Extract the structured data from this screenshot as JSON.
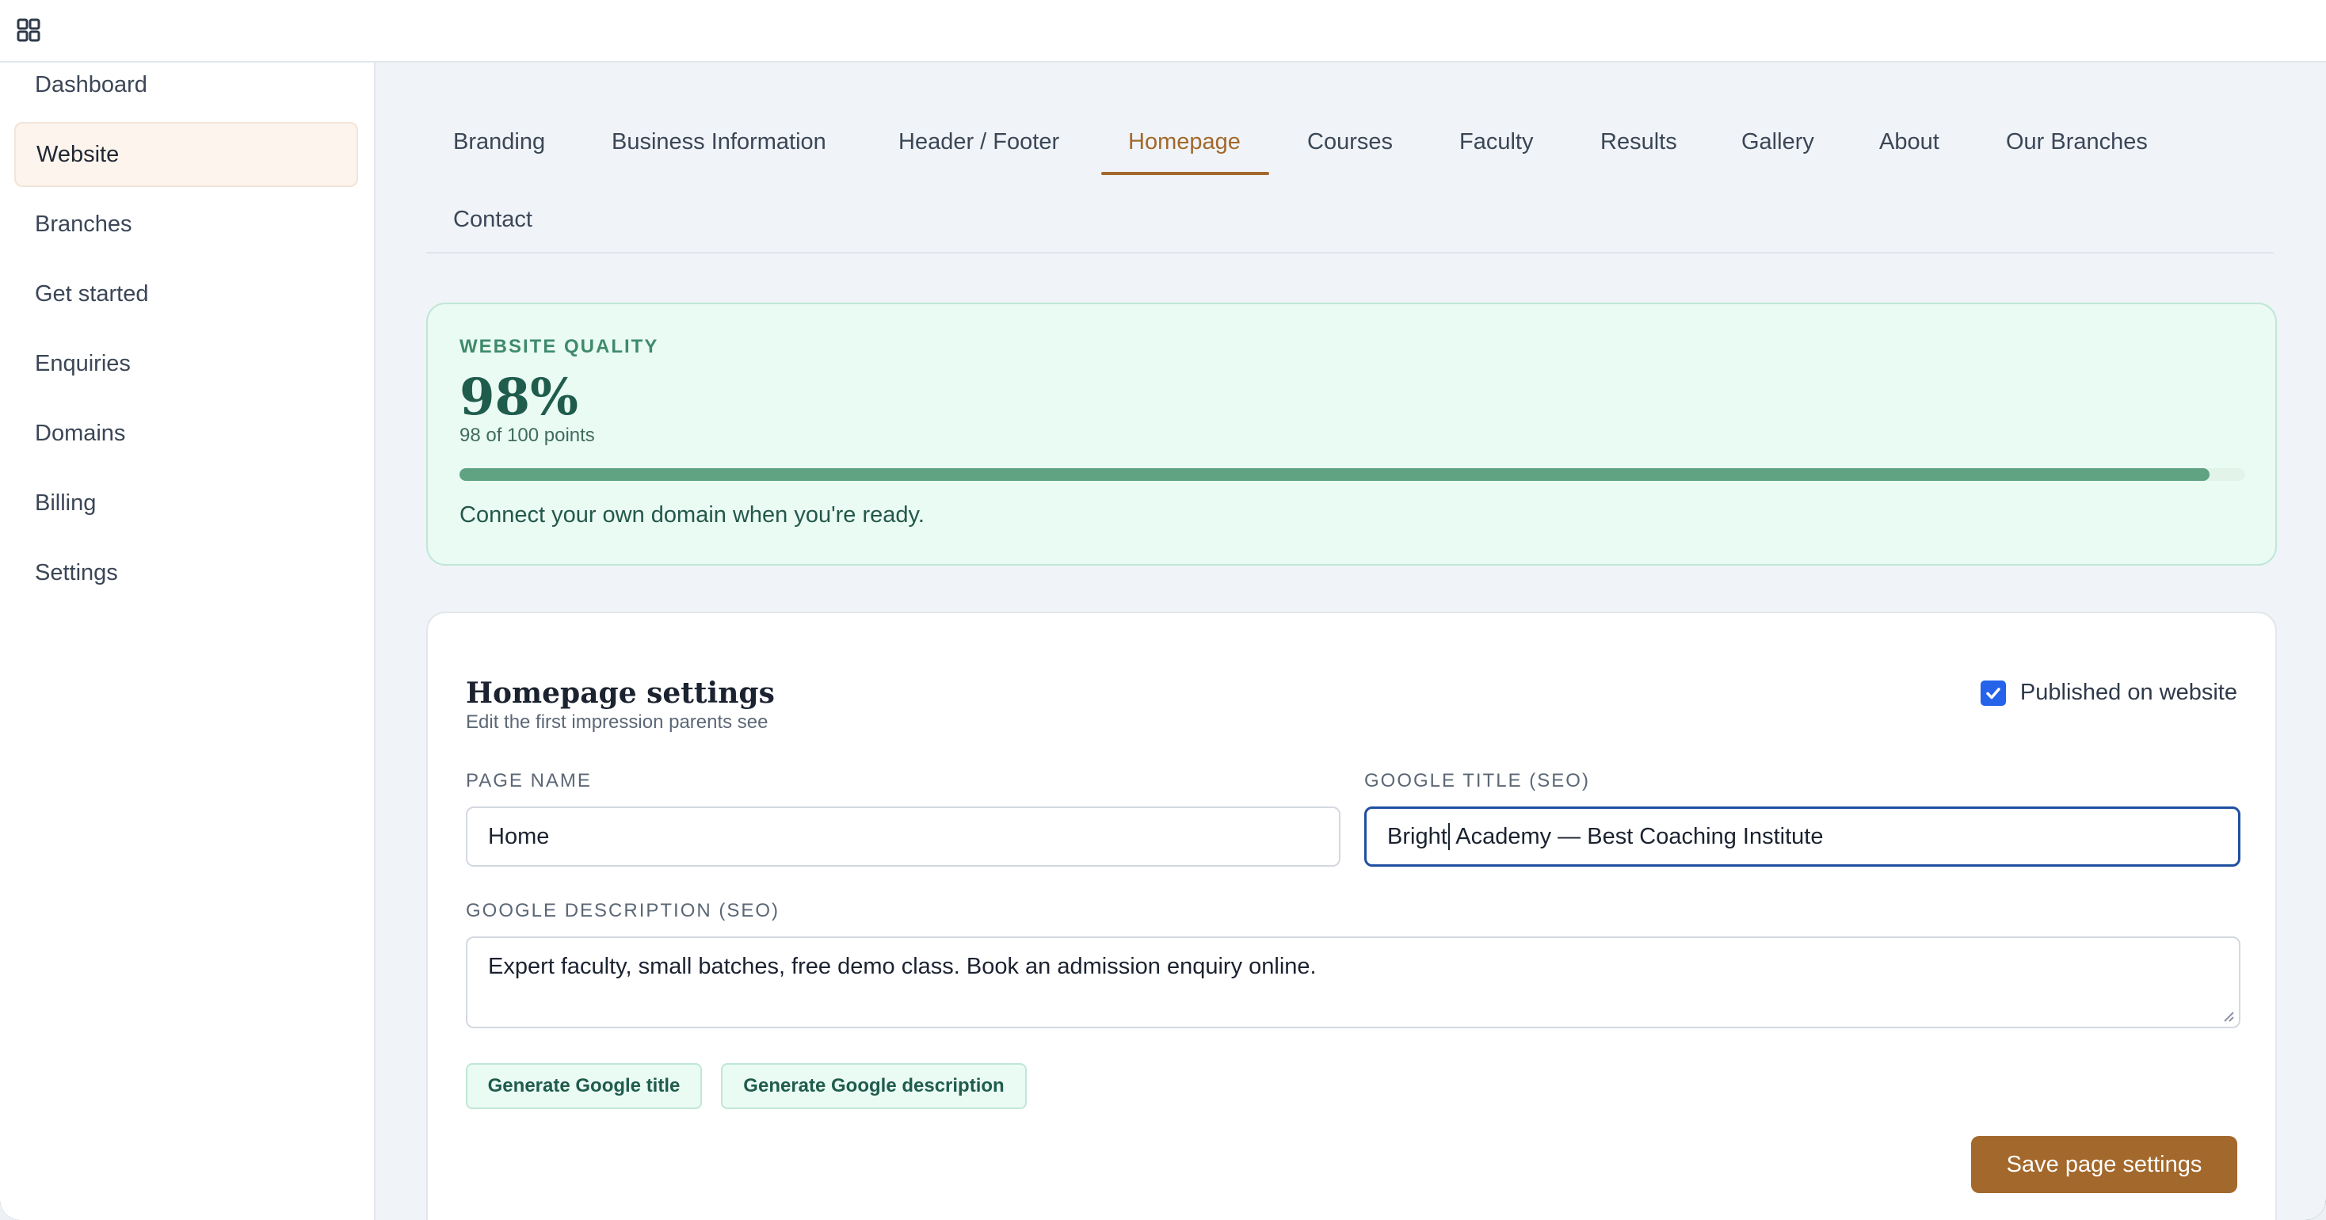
{
  "sidebar": {
    "items": [
      {
        "label": "Dashboard"
      },
      {
        "label": "Website"
      },
      {
        "label": "Branches"
      },
      {
        "label": "Get started"
      },
      {
        "label": "Enquiries"
      },
      {
        "label": "Domains"
      },
      {
        "label": "Billing"
      },
      {
        "label": "Settings"
      }
    ],
    "active": "Website"
  },
  "tabs": [
    {
      "label": "Branding"
    },
    {
      "label": "Business Information"
    },
    {
      "label": "Header / Footer"
    },
    {
      "label": "Homepage"
    },
    {
      "label": "Courses"
    },
    {
      "label": "Faculty"
    },
    {
      "label": "Results"
    },
    {
      "label": "Gallery"
    },
    {
      "label": "About"
    },
    {
      "label": "Our Branches"
    },
    {
      "label": "Contact"
    }
  ],
  "active_tab": "Homepage",
  "quality": {
    "label": "WEBSITE QUALITY",
    "value": "98%",
    "points": "98 of 100 points",
    "progress": 0.98,
    "hint": "Connect your own domain when you're ready."
  },
  "homepage_settings": {
    "title": "Homepage settings",
    "subtitle": "Edit the first impression parents see",
    "published_label": "Published on website",
    "published": true,
    "page_name_label": "PAGE NAME",
    "page_name_value": "Home",
    "google_title_label": "GOOGLE TITLE (SEO)",
    "google_title_before_caret": "Bright",
    "google_title_after_caret": " Academy — Best Coaching Institute",
    "google_description_label": "GOOGLE DESCRIPTION (SEO)",
    "google_description_value": "Expert faculty, small batches, free demo class. Book an admission enquiry online.",
    "generate_title_button": "Generate Google title",
    "generate_description_button": "Generate Google description",
    "save_button": "Save page settings"
  },
  "colors": {
    "accent": "#a3682b",
    "quality_green": "#5fa383",
    "checkbox_blue": "#2563eb",
    "focus_border": "#1e4fa0"
  },
  "icons": {
    "top_left": "apps-grid-icon",
    "checkbox": "check-icon"
  }
}
